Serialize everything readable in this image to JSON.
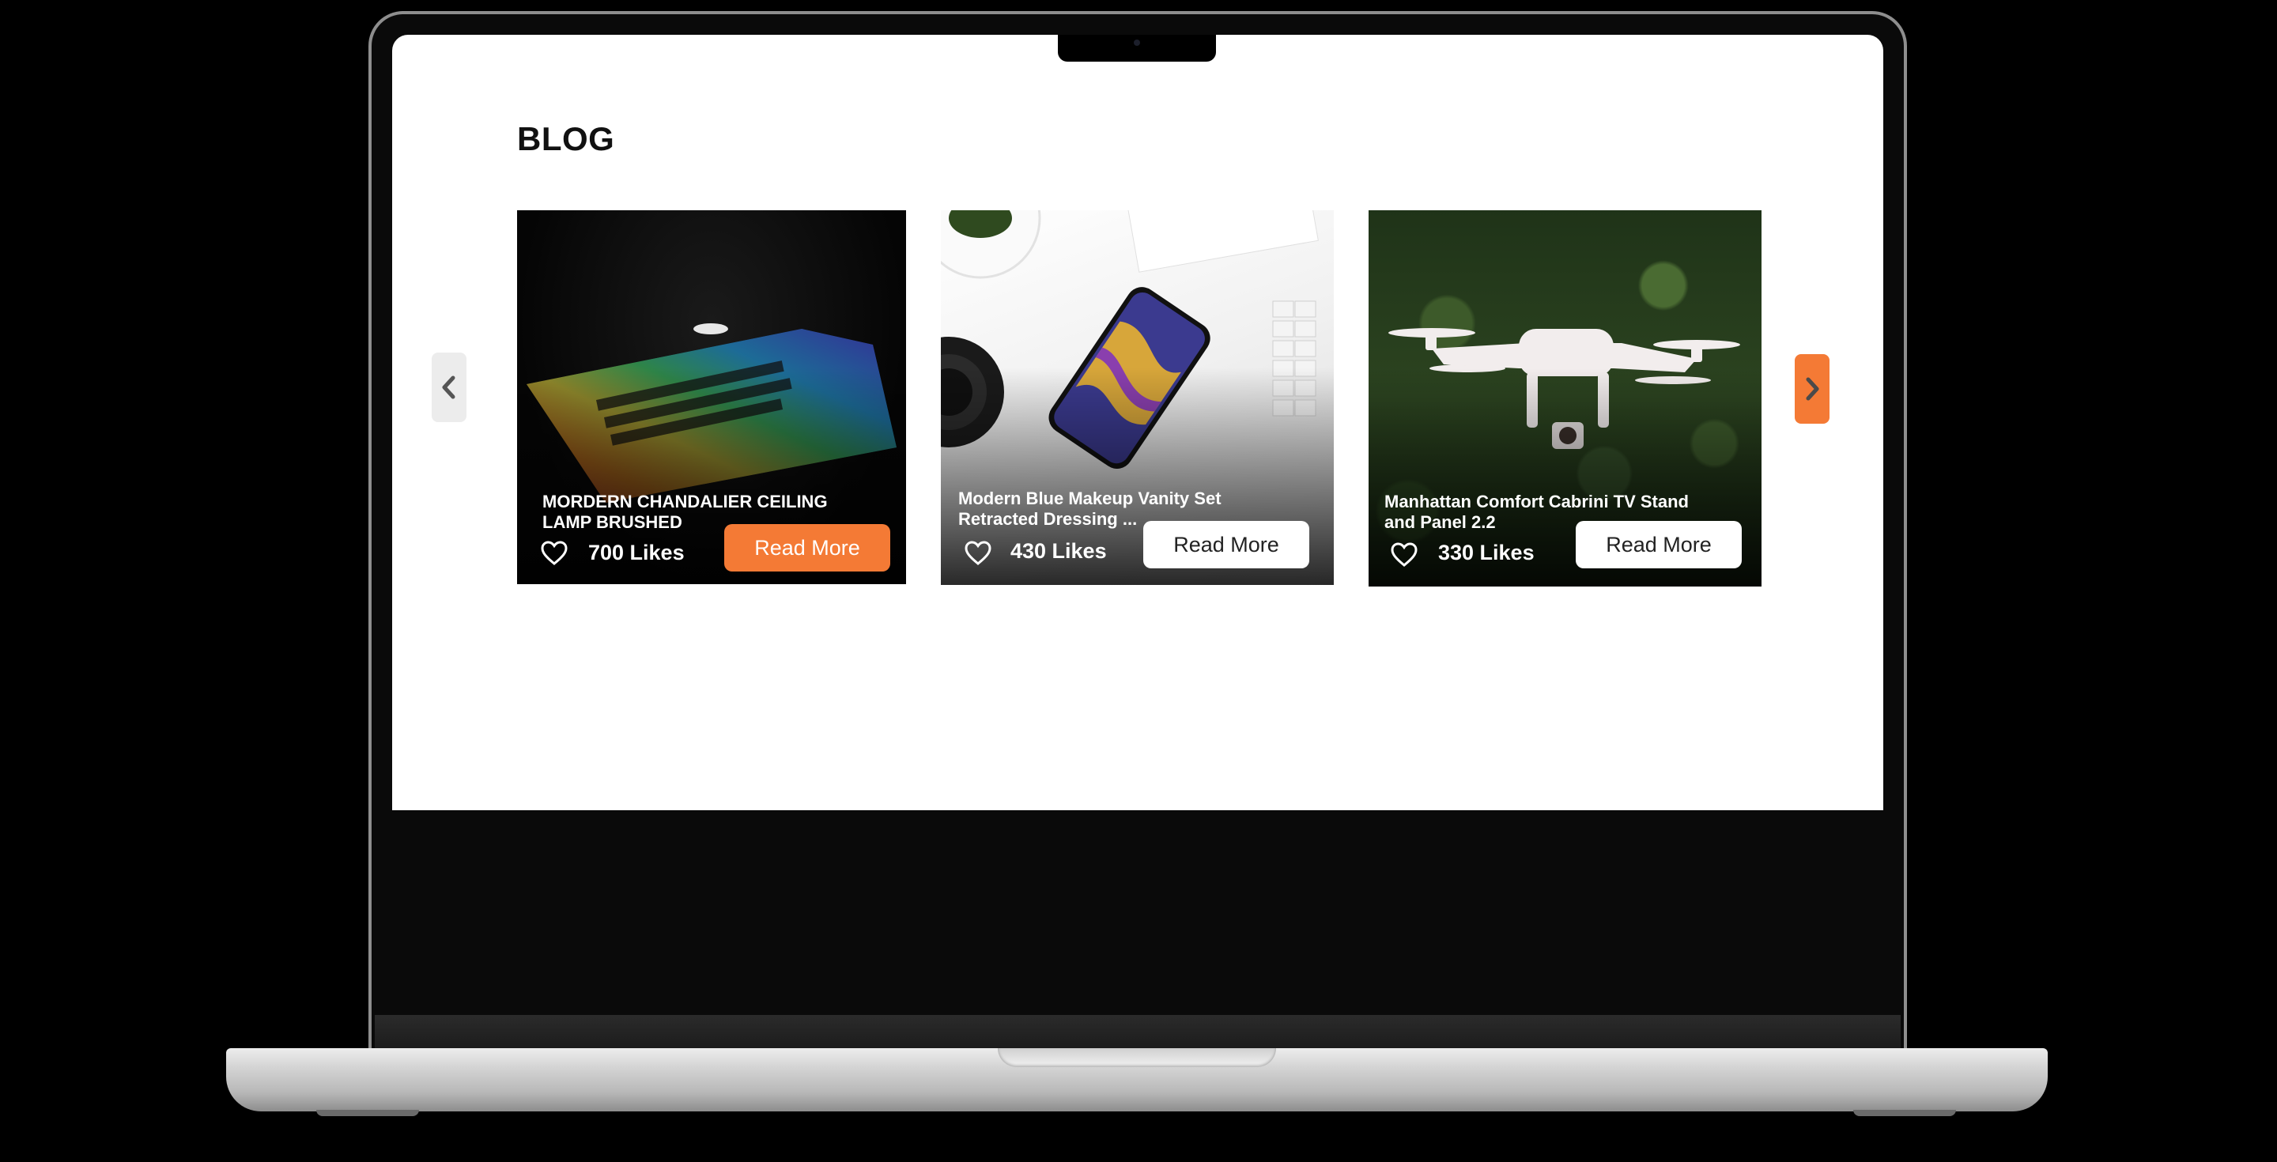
{
  "page": {
    "title": "BLOG"
  },
  "carousel": {
    "prev_icon": "chevron-left-icon",
    "next_icon": "chevron-right-icon",
    "accent_color": "#f47a35"
  },
  "posts": [
    {
      "image": "laptop-rainbow-keyboard",
      "title": "MORDERN CHANDALIER CEILING LAMP BRUSHED",
      "likes": "700 Likes",
      "button": "Read More",
      "button_style": "orange"
    },
    {
      "image": "smartphone-on-white-desk",
      "title": "Modern Blue Makeup Vanity Set Retracted Dressing ...",
      "likes": "430 Likes",
      "button": "Read More",
      "button_style": "white"
    },
    {
      "image": "white-drone-over-forest",
      "title": "Manhattan Comfort Cabrini TV Stand and Panel 2.2",
      "likes": "330 Likes",
      "button": "Read More",
      "button_style": "white"
    }
  ]
}
